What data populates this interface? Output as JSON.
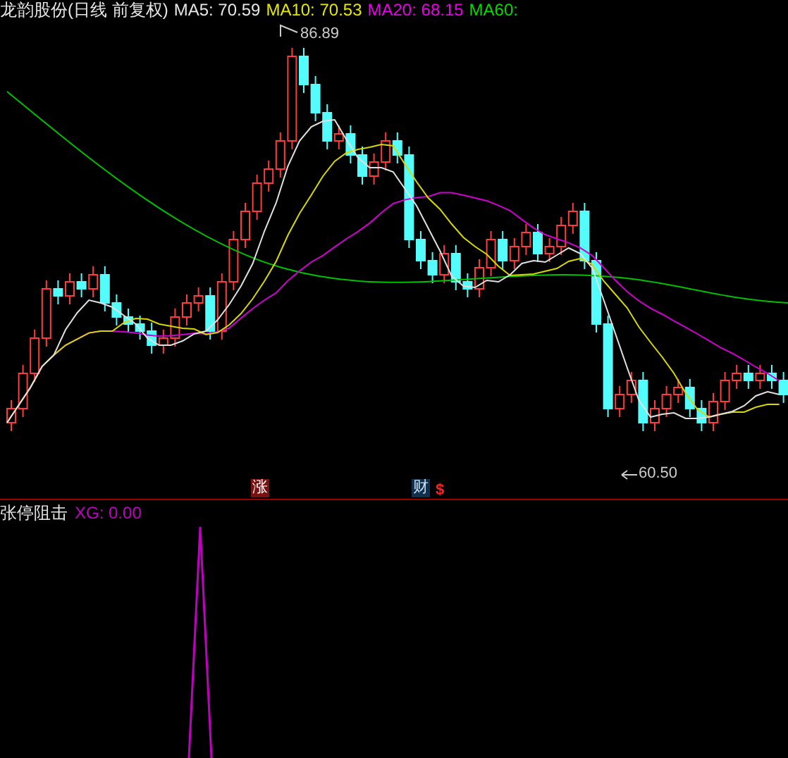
{
  "header": {
    "title": "龙韵股份(日线 前复权)",
    "indicators": [
      {
        "label": "MA5: 70.59",
        "color": "#e6e6e6"
      },
      {
        "label": "MA10: 70.53",
        "color": "#e6e600"
      },
      {
        "label": "MA20: 68.15",
        "color": "#e600e6"
      },
      {
        "label": "MA60:",
        "color": "#00d800"
      }
    ]
  },
  "price_chart": {
    "high_label": "86.89",
    "low_label": "60.50",
    "markers": [
      {
        "text": "涨",
        "kind": "limit-up"
      },
      {
        "text": "财",
        "kind": "finance"
      },
      {
        "text": "$",
        "kind": "dividend"
      }
    ]
  },
  "indicator_panel": {
    "title": "张停阻击",
    "reading": "XG: 0.00"
  }
}
